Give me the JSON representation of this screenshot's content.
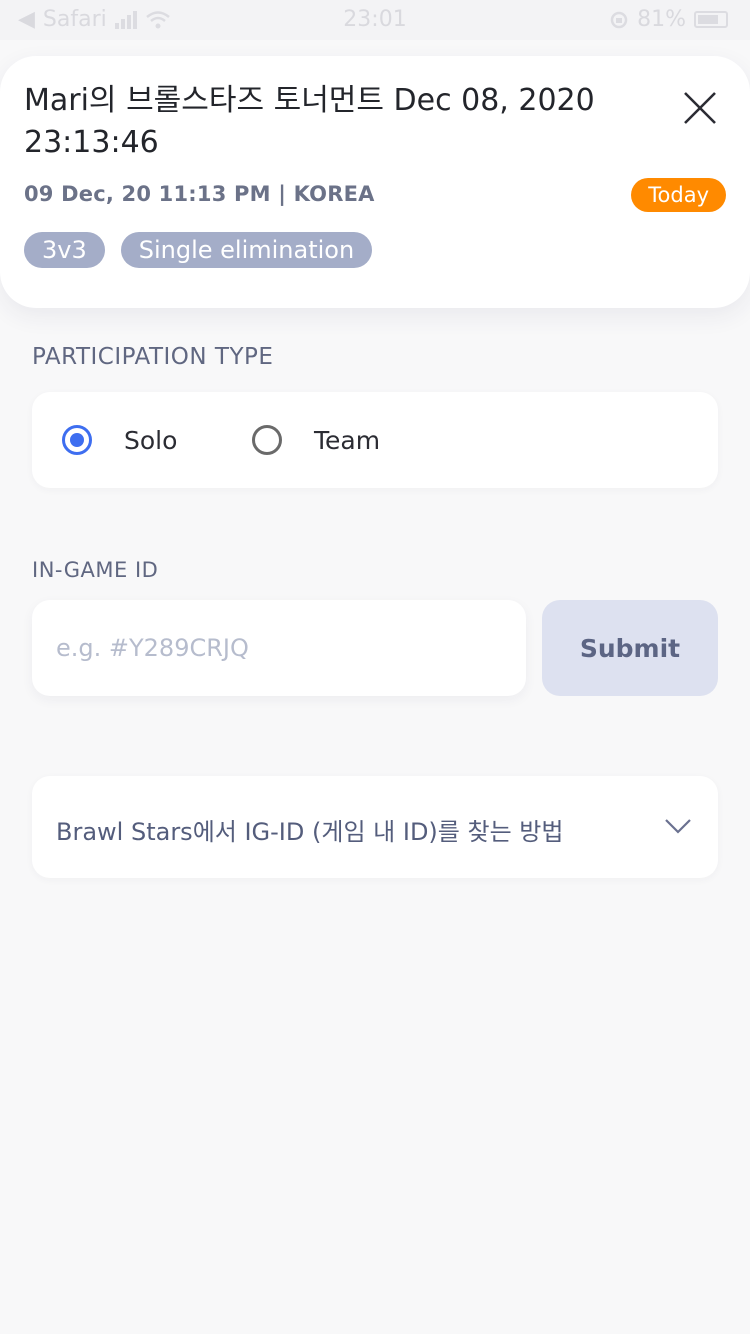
{
  "status_bar": {
    "app": "Safari",
    "time": "23:01",
    "battery": "81%"
  },
  "tournament": {
    "title": "Mari의 브롤스타즈 토너먼트 Dec 08, 2020 23:13:46",
    "meta": "09 Dec, 20 11:13 PM | KOREA",
    "badge": "Today",
    "tags": [
      "3v3",
      "Single elimination"
    ]
  },
  "participation": {
    "label": "PARTICIPATION TYPE",
    "options": [
      {
        "label": "Solo",
        "selected": true
      },
      {
        "label": "Team",
        "selected": false
      }
    ]
  },
  "ingame": {
    "label": "IN-GAME ID",
    "placeholder": "e.g. #Y289CRJQ",
    "value": "",
    "submit_label": "Submit"
  },
  "howto": {
    "label": "Brawl Stars에서 IG-ID (게임 내 ID)를 찾는 방법"
  },
  "colors": {
    "accent": "#3e6ef0",
    "badge": "#ff8a00",
    "tag": "#a4adc8",
    "submit_bg": "#dde1f0"
  }
}
